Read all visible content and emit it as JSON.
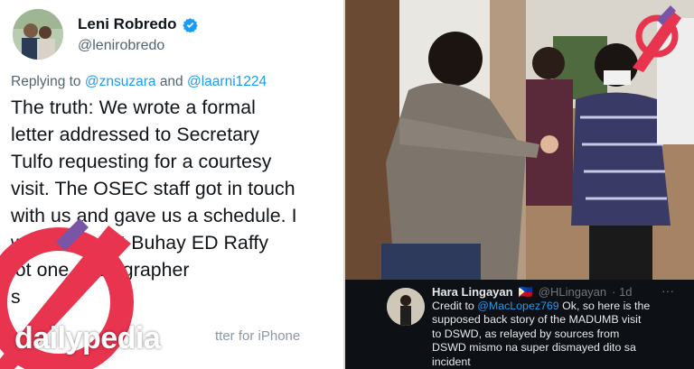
{
  "tweet": {
    "display_name": "Leni Robredo",
    "handle": "@lenirobredo",
    "reply_prefix": "Replying to",
    "reply_mention_1": "@znsuzara",
    "reply_and": "and",
    "reply_mention_2": "@laarni1224",
    "text_lines": [
      "The truth: We wrote a formal",
      "letter addressed to Secretary",
      "Tulfo requesting for a courtesy",
      "visit. The OSEC staff got in touch",
      "with us and gave us a schedule. I",
      "went w   Angat Buhay ED Raffy",
      "         lot one photographer",
      "     s"
    ],
    "source": "tter for iPhone"
  },
  "brand": {
    "name": "dailypedia",
    "color": "#e8344e"
  },
  "reply_card": {
    "name": "Hara Lingayan",
    "flag": "🇵🇭",
    "handle": "@HLingayan",
    "time": "· 1d",
    "menu": "···",
    "prefix": "Credit to",
    "mention": "@MacLopez769",
    "lines": [
      " Ok, so here is the",
      "supposed back story of the MADUMB visit",
      "to DSWD, as relayed by sources from",
      "DSWD mismo na super dismayed dito sa",
      "incident"
    ]
  },
  "colors": {
    "twitter_blue": "#1d9bf0",
    "text_dark": "#0f1419",
    "text_gray": "#536471"
  }
}
